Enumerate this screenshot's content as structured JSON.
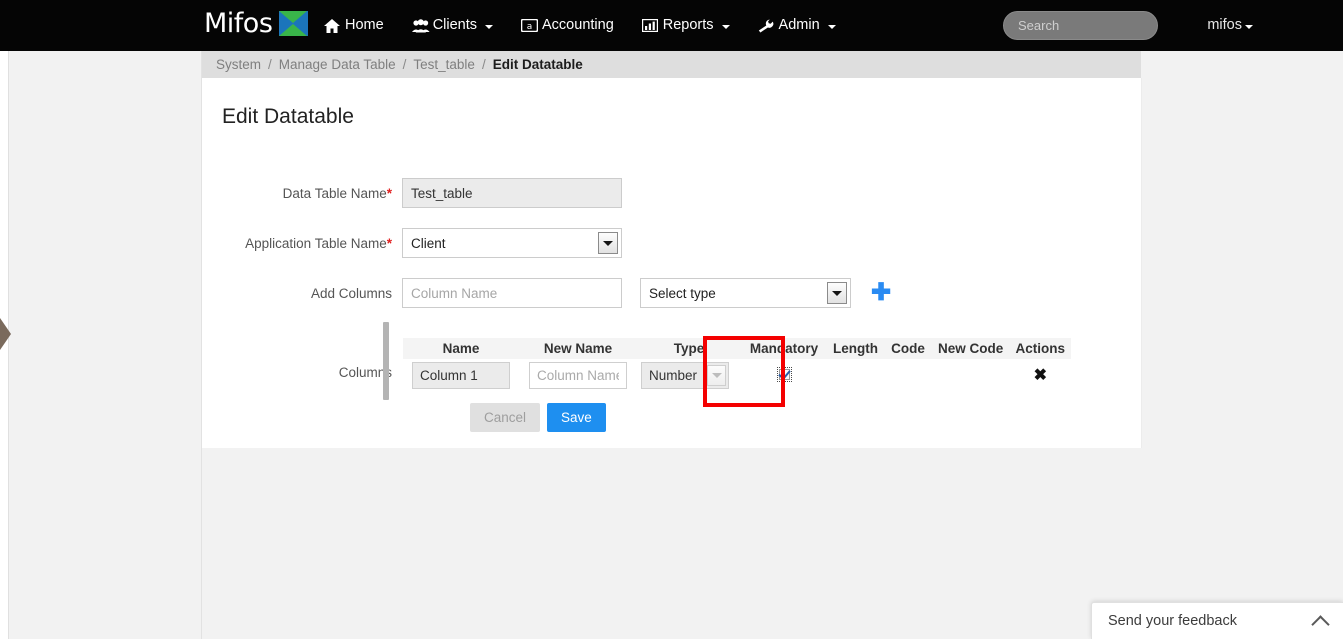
{
  "navbar": {
    "brand": "Mifos",
    "brand_icon": "mifos-logo-icon",
    "items": [
      {
        "label": "Home",
        "icon": "home-icon",
        "caret": false
      },
      {
        "label": "Clients",
        "icon": "users-icon",
        "caret": true
      },
      {
        "label": "Accounting",
        "icon": "accounting-icon",
        "caret": false
      },
      {
        "label": "Reports",
        "icon": "bar-chart-icon",
        "caret": true
      },
      {
        "label": "Admin",
        "icon": "wrench-icon",
        "caret": true
      }
    ],
    "search": {
      "placeholder": "Search",
      "value": ""
    },
    "user": "mifos"
  },
  "breadcrumb": {
    "items": [
      "System",
      "Manage Data Table",
      "Test_table"
    ],
    "current": "Edit Datatable",
    "separator": "/"
  },
  "page": {
    "title": "Edit Datatable"
  },
  "form": {
    "data_table_name": {
      "label": "Data Table Name",
      "required_marker": "*",
      "value": "Test_table"
    },
    "application_table_name": {
      "label": "Application Table Name",
      "required_marker": "*",
      "value": "Client"
    },
    "add_columns": {
      "label": "Add Columns",
      "name_placeholder": "Column Name",
      "name_value": "",
      "type_value": "Select type",
      "add_icon": "plus-icon"
    },
    "columns": {
      "label": "Columns",
      "headers": [
        "Name",
        "New Name",
        "Type",
        "Mandatory",
        "Length",
        "Code",
        "New Code",
        "Actions"
      ],
      "rows": [
        {
          "name": "Column 1",
          "new_name_placeholder": "Column Name",
          "new_name_value": "",
          "type": "Number",
          "mandatory": true,
          "length": "",
          "code": "",
          "new_code": "",
          "action_icon": "delete-x-icon"
        }
      ]
    },
    "buttons": {
      "cancel": "Cancel",
      "save": "Save"
    }
  },
  "feedback": {
    "label": "Send your feedback",
    "icon": "chevron-up-icon"
  },
  "annotation": {
    "highlight_color": "#f40000",
    "highlight_target": "Mandatory"
  },
  "colors": {
    "navbar_bg": "#050505",
    "accent_blue": "#1e8ff0",
    "breadcrumb_bg": "#dedede",
    "page_bg": "#f2f2f2",
    "required_red": "#e02020"
  }
}
